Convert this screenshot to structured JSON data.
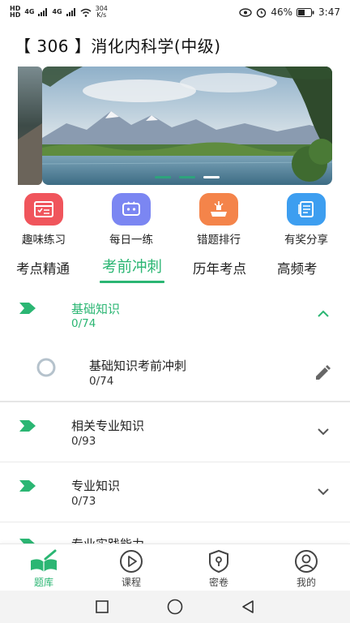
{
  "status_bar": {
    "hd1": "HD",
    "hd2": "HD",
    "signal1": "4G",
    "signal2": "4G",
    "net_speed": "304",
    "net_unit": "K/s",
    "battery": "46%",
    "time": "3:47"
  },
  "header": {
    "title": "【 306 】消化内科学(中级)"
  },
  "banner": {
    "dot_count": 3,
    "active_index": 2
  },
  "quick_actions": [
    {
      "label": "趣味练习",
      "icon": "fun-practice-icon",
      "color": "#f0555c"
    },
    {
      "label": "每日一练",
      "icon": "daily-practice-icon",
      "color": "#7b86f2"
    },
    {
      "label": "错题排行",
      "icon": "wrong-ranking-icon",
      "color": "#f4844a"
    },
    {
      "label": "有奖分享",
      "icon": "reward-share-icon",
      "color": "#3d9ef0"
    }
  ],
  "tabs": [
    {
      "label": "考点精通"
    },
    {
      "label": "考前冲刺",
      "active": true
    },
    {
      "label": "历年考点"
    },
    {
      "label": "高频考"
    }
  ],
  "chapters": {
    "c1": {
      "title": "基础知识",
      "count": "0/74",
      "expanded": true
    },
    "c1_sub": {
      "title": "基础知识考前冲刺",
      "count": "0/74"
    },
    "c2": {
      "title": "相关专业知识",
      "count": "0/93"
    },
    "c3": {
      "title": "专业知识",
      "count": "0/73"
    },
    "c4": {
      "title": "专业实践能力"
    }
  },
  "bottom_nav": [
    {
      "label": "题库",
      "icon": "question-bank-icon",
      "active": true
    },
    {
      "label": "课程",
      "icon": "play-circle-icon"
    },
    {
      "label": "密卷",
      "icon": "lock-shield-icon"
    },
    {
      "label": "我的",
      "icon": "user-icon"
    }
  ],
  "colors": {
    "accent": "#2bb673",
    "text": "#222222",
    "divider": "#eaeaea"
  }
}
